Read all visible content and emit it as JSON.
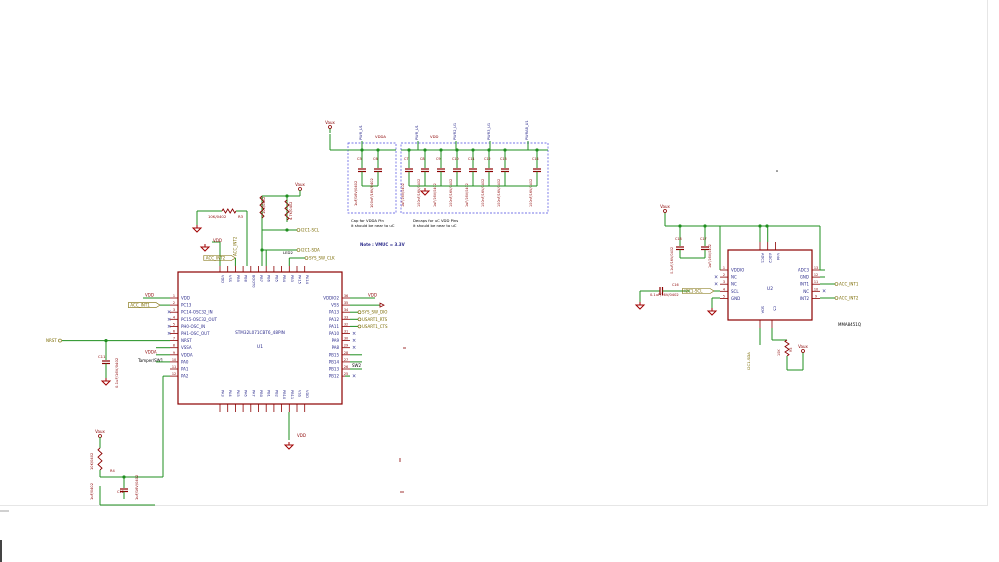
{
  "colors": {
    "background": "#ffffff",
    "wire": "#1f8f1f",
    "component": "#8b0000",
    "pin_text": "#2c2c8c",
    "label": "#7a6a00",
    "net_power": "#8b0000",
    "note_box": "#4a4adf",
    "gnd": "#a00000",
    "junction": "#1f8f1f"
  },
  "u1": {
    "ref": "U1",
    "value": "STM32L071CBT6_48PIN",
    "left_pins": [
      {
        "num": "1",
        "name": "VDD"
      },
      {
        "num": "2",
        "name": "PC13"
      },
      {
        "num": "3",
        "name": "PC14-OSC32_IN"
      },
      {
        "num": "4",
        "name": "PC15-OSC32_OUT"
      },
      {
        "num": "5",
        "name": "PH0-OSC_IN"
      },
      {
        "num": "6",
        "name": "PH1-OSC_OUT"
      },
      {
        "num": "7",
        "name": "NRST"
      },
      {
        "num": "8",
        "name": "VSSA"
      },
      {
        "num": "9",
        "name": "VDDA"
      },
      {
        "num": "10",
        "name": "PA0"
      },
      {
        "num": "11",
        "name": "PA1"
      },
      {
        "num": "12",
        "name": "PA2"
      }
    ],
    "right_pins": [
      {
        "num": "36",
        "name": "VDDIO2"
      },
      {
        "num": "35",
        "name": "VSS"
      },
      {
        "num": "34",
        "name": "PA13"
      },
      {
        "num": "33",
        "name": "PA12"
      },
      {
        "num": "32",
        "name": "PA11"
      },
      {
        "num": "31",
        "name": "PA10"
      },
      {
        "num": "30",
        "name": "PA9"
      },
      {
        "num": "29",
        "name": "PA8"
      },
      {
        "num": "28",
        "name": "PB15"
      },
      {
        "num": "27",
        "name": "PB14"
      },
      {
        "num": "26",
        "name": "PB13"
      },
      {
        "num": "25",
        "name": "PB12"
      }
    ],
    "top_pins": [
      "VDD",
      "VSS",
      "PB9",
      "PB8",
      "BOOT0",
      "PB7",
      "PB6",
      "PB5",
      "PB4",
      "PB3",
      "PA15",
      "PA14"
    ],
    "bottom_pins": [
      "PA3",
      "PA4",
      "PA5",
      "PA6",
      "PA7",
      "PB0",
      "PB1",
      "PB2",
      "PB10",
      "PB11",
      "VSS",
      "VDD"
    ]
  },
  "u2": {
    "ref": "U2",
    "value": "MMA8451Q",
    "left_pins": [
      {
        "num": "1",
        "name": "VDDIO"
      },
      {
        "num": "2",
        "name": "NC"
      },
      {
        "num": "3",
        "name": "NC"
      },
      {
        "num": "4",
        "name": "SCL"
      },
      {
        "num": "5",
        "name": "GND"
      }
    ],
    "right_pins": [
      {
        "num": "13",
        "name": "ADC3"
      },
      {
        "num": "12",
        "name": "GND"
      },
      {
        "num": "11",
        "name": "INT1"
      },
      {
        "num": "10",
        "name": "NC"
      },
      {
        "num": "9",
        "name": "INT2"
      }
    ],
    "top_pins": [
      "ADC1",
      "ADC2",
      "Vdd"
    ],
    "bottom_pins": [
      "SDA",
      "C5"
    ]
  },
  "nets": {
    "vddx": "Vaux",
    "vdd": "VDD",
    "vdda": "VDDA",
    "nrst": "NRST",
    "acc_int1": "ACC_INT1",
    "acc_int2": "ACC_INT2",
    "i2c1_scl": "I2C1-SCL",
    "i2c1_sda": "I2C1-SDA",
    "sys_swclk": "SYS_SW_CLK",
    "sys_swdio": "SYS_SW_DIO",
    "usart1_rts": "USART1_RTS",
    "usart1_cts": "USART1_CTS",
    "tamper": "Tamper/SW1",
    "sw2": "SW2",
    "led1": "LED1",
    "led2": "LED2"
  },
  "components": {
    "r3": {
      "ref": "R3",
      "value": "10K/0402"
    },
    "r_boot": {
      "ref": "R1",
      "value": "10K/0402"
    },
    "r_pullup": {
      "ref": "R2",
      "value": "4.7K/0402"
    },
    "r_nrst": {
      "ref": "R4",
      "value": "10K/0402"
    },
    "r_led": {
      "ref": "R5",
      "value": "1K/0402"
    },
    "c11": {
      "ref": "C11",
      "value": "0.1uF/16V/0402"
    },
    "c12": {
      "ref": "C12",
      "value": "1uF/16V/0402"
    },
    "c5": {
      "ref": "C5",
      "value": "1uF/16V/0402"
    },
    "c6": {
      "ref": "C6",
      "value": "100nF/16V/0402"
    },
    "c7": {
      "ref": "C7",
      "value": "1uF/16V/0402"
    },
    "c8": {
      "ref": "C8",
      "value": "100nF/16V/0402"
    },
    "c9": {
      "ref": "C9",
      "value": "1uF/16V/0402"
    },
    "c10": {
      "ref": "C10",
      "value": "100nF/16V/0402"
    },
    "c11b": {
      "ref": "C11",
      "value": "1uF/16V/0402"
    },
    "c12b": {
      "ref": "C12",
      "value": "100nF/16V/0402"
    },
    "c13": {
      "ref": "C13",
      "value": "100nF/16V/0402"
    },
    "c14": {
      "ref": "C14",
      "value": "100nF/16V/0402"
    },
    "c16": {
      "ref": "C16",
      "value": "0.1uF/16V/0402"
    },
    "c17": {
      "ref": "C17",
      "value": "1uF/16V/0402"
    },
    "c18": {
      "ref": "C18",
      "value": "0.1uF/16V/0402"
    },
    "gnd_nrst": {
      "ref": "",
      "value": "1uF/0402"
    }
  },
  "power_tags": {
    "pwr_u1": "PWR_U1",
    "pwr_u1b": "PWR_U1",
    "pwr_u1c": "PWR2_U1",
    "pwr_u1d": "PWR3_U1",
    "pwr_u1e": "PWRAB_U1"
  },
  "notes": {
    "vdda_box_line1": "Cap for VDDA Pin",
    "vdda_box_line2": "it should be near to uC",
    "vdd_box_line1": "Decaps for uC VDD Pins",
    "vdd_box_line2": "it should be near to uC",
    "vmuc": "Note : VMUC = 3.3V"
  }
}
